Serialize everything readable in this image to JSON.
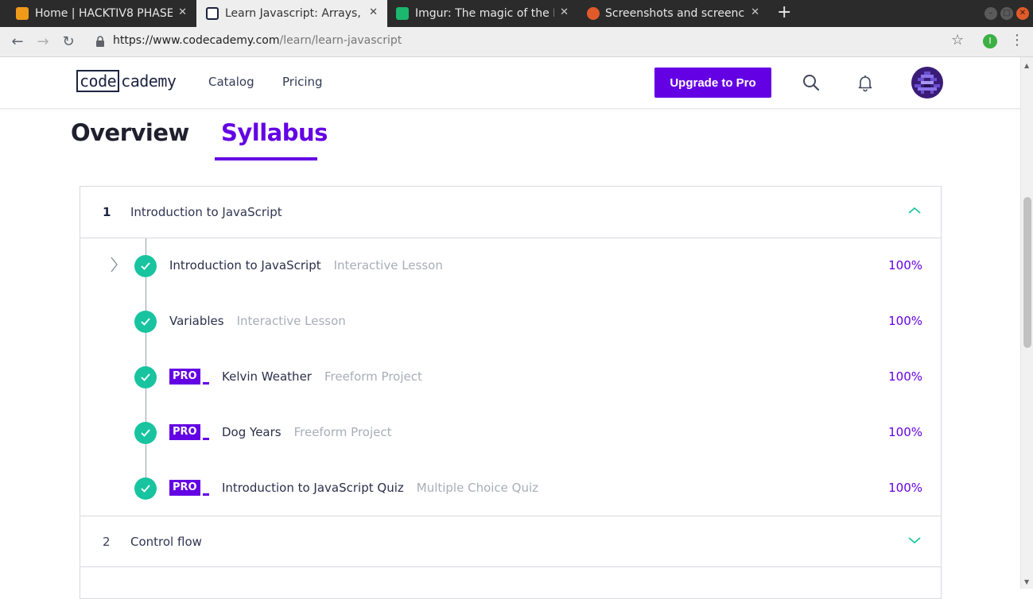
{
  "browser": {
    "tabs": [
      {
        "title": "Home | HACKTIV8 PHASE",
        "favicon_color": "#f09a1a",
        "active": false
      },
      {
        "title": "Learn Javascript: Arrays, L",
        "favicon_color": "#1d2340",
        "active": true
      },
      {
        "title": "Imgur: The magic of the In",
        "favicon_color": "#1bb76e",
        "active": false
      },
      {
        "title": "Screenshots and screenca",
        "favicon_color": "#e05a2a",
        "active": false
      }
    ],
    "url_host": "https://www.codecademy.com",
    "url_path": "/learn/learn-javascript",
    "extension_letter": "I"
  },
  "header": {
    "logo_boxed": "code",
    "logo_rest": "cademy",
    "nav": [
      "Catalog",
      "Pricing"
    ],
    "upgrade_label": "Upgrade to Pro"
  },
  "page_tabs": {
    "overview": "Overview",
    "syllabus": "Syllabus",
    "active": "syllabus"
  },
  "modules": [
    {
      "number": "1",
      "title": "Introduction to JavaScript",
      "expanded": true,
      "lessons": [
        {
          "title": "Introduction to JavaScript",
          "type": "Interactive Lesson",
          "progress": "100%",
          "pro": false,
          "completed": true
        },
        {
          "title": "Variables",
          "type": "Interactive Lesson",
          "progress": "100%",
          "pro": false,
          "completed": true
        },
        {
          "title": "Kelvin Weather",
          "type": "Freeform Project",
          "progress": "100%",
          "pro": true,
          "completed": true
        },
        {
          "title": "Dog Years",
          "type": "Freeform Project",
          "progress": "100%",
          "pro": true,
          "completed": true
        },
        {
          "title": "Introduction to JavaScript Quiz",
          "type": "Multiple Choice Quiz",
          "progress": "100%",
          "pro": true,
          "completed": true
        }
      ]
    },
    {
      "number": "2",
      "title": "Control flow",
      "expanded": false
    }
  ],
  "pro_badge": "PRO",
  "colors": {
    "brand_purple": "#6400e4",
    "check_teal": "#18c4a0",
    "chevron_teal": "#18c4a0"
  }
}
